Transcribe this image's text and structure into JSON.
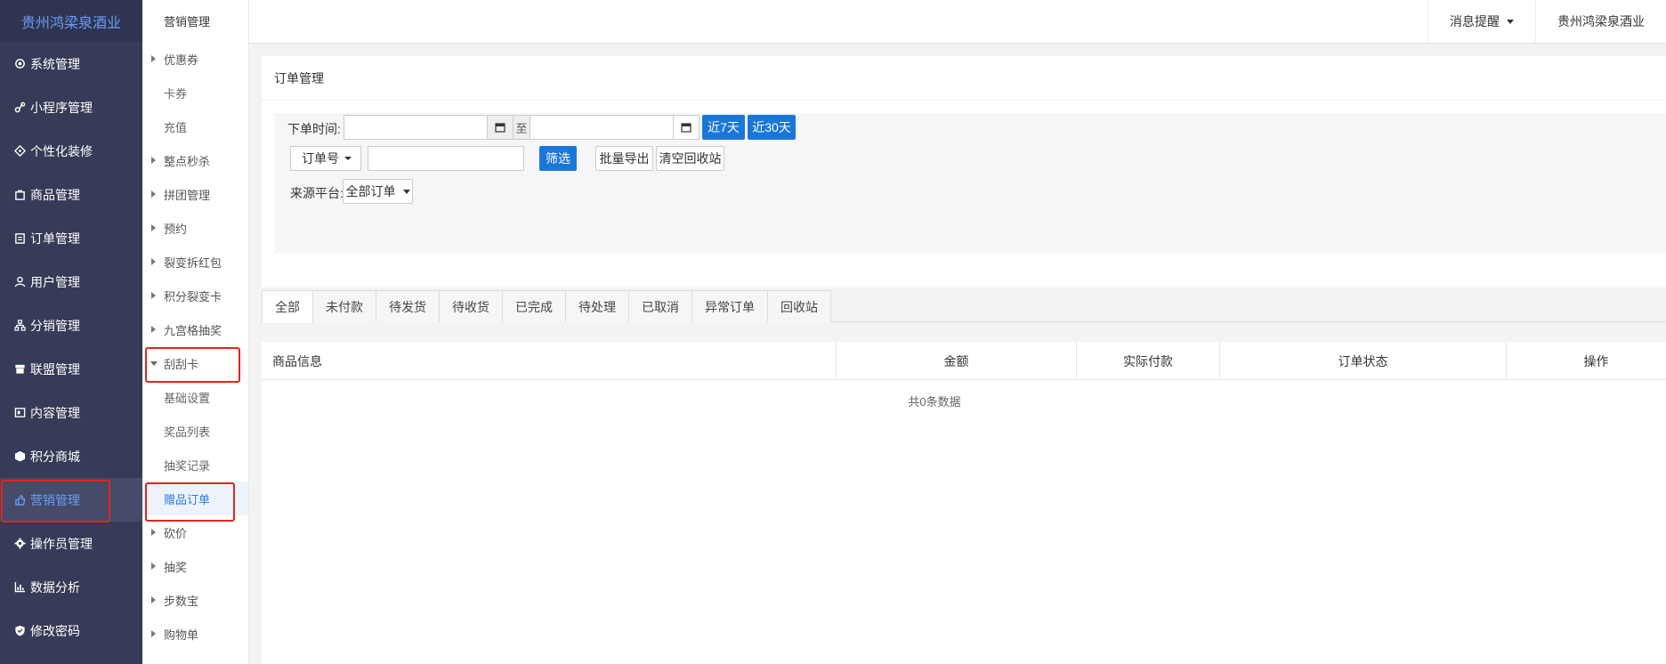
{
  "brand": "贵州鸿梁泉酒业",
  "sidebar": {
    "items": [
      {
        "label": "系统管理",
        "icon": "gear-icon"
      },
      {
        "label": "小程序管理",
        "icon": "link-icon"
      },
      {
        "label": "个性化装修",
        "icon": "palette-icon"
      },
      {
        "label": "商品管理",
        "icon": "bag-icon"
      },
      {
        "label": "订单管理",
        "icon": "clipboard-icon"
      },
      {
        "label": "用户管理",
        "icon": "user-icon"
      },
      {
        "label": "分销管理",
        "icon": "network-icon"
      },
      {
        "label": "联盟管理",
        "icon": "store-icon"
      },
      {
        "label": "内容管理",
        "icon": "content-icon"
      },
      {
        "label": "积分商城",
        "icon": "cube-icon"
      },
      {
        "label": "营销管理",
        "icon": "hand-icon"
      },
      {
        "label": "操作员管理",
        "icon": "cog-icon"
      },
      {
        "label": "数据分析",
        "icon": "chart-icon"
      },
      {
        "label": "修改密码",
        "icon": "shield-icon"
      }
    ]
  },
  "subnav": {
    "title": "营销管理",
    "items": [
      {
        "label": "优惠券",
        "type": "group"
      },
      {
        "label": "卡券",
        "type": "child"
      },
      {
        "label": "充值",
        "type": "child"
      },
      {
        "label": "整点秒杀",
        "type": "group"
      },
      {
        "label": "拼团管理",
        "type": "group"
      },
      {
        "label": "预约",
        "type": "group"
      },
      {
        "label": "裂变拆红包",
        "type": "group"
      },
      {
        "label": "积分裂变卡",
        "type": "group"
      },
      {
        "label": "九宫格抽奖",
        "type": "group"
      },
      {
        "label": "刮刮卡",
        "type": "open"
      },
      {
        "label": "基础设置",
        "type": "child"
      },
      {
        "label": "奖品列表",
        "type": "child"
      },
      {
        "label": "抽奖记录",
        "type": "child"
      },
      {
        "label": "赠品订单",
        "type": "selected"
      },
      {
        "label": "砍价",
        "type": "group"
      },
      {
        "label": "抽奖",
        "type": "group"
      },
      {
        "label": "步数宝",
        "type": "group"
      },
      {
        "label": "购物单",
        "type": "group"
      }
    ]
  },
  "header": {
    "notify": "消息提醒",
    "company": "贵州鸿梁泉酒业"
  },
  "panel": {
    "title": "订单管理",
    "order_time_label": "下单时间:",
    "to": "至",
    "btn_7days": "近7天",
    "btn_30days": "近30天",
    "search_field": "订单号",
    "search_value": "",
    "btn_filter": "筛选",
    "btn_export": "批量导出",
    "btn_clear": "清空回收站",
    "source_label": "来源平台:",
    "source_value": "全部订单"
  },
  "tabs": [
    "全部",
    "未付款",
    "待发货",
    "待收货",
    "已完成",
    "待处理",
    "已取消",
    "异常订单",
    "回收站"
  ],
  "table": {
    "columns": [
      "商品信息",
      "金额",
      "实际付款",
      "订单状态",
      "操作"
    ],
    "empty": "共0条数据"
  }
}
